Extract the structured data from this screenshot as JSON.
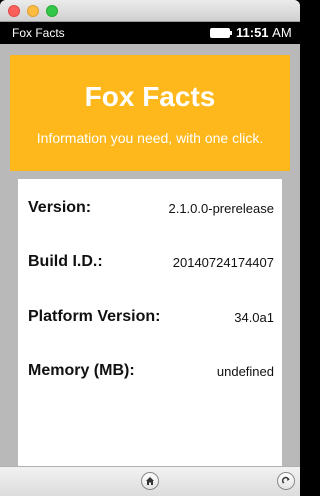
{
  "status_bar": {
    "app_title": "Fox Facts",
    "time": "11:51",
    "ampm": "AM"
  },
  "header": {
    "title": "Fox Facts",
    "subtitle": "Information you need, with one click."
  },
  "facts": [
    {
      "label": "Version:",
      "value": "2.1.0.0-prerelease"
    },
    {
      "label": "Build I.D.:",
      "value": "20140724174407"
    },
    {
      "label": "Platform Version:",
      "value": "34.0a1"
    },
    {
      "label": "Memory (MB):",
      "value": "undefined"
    }
  ],
  "colors": {
    "header_bg": "#ffb81c",
    "frame_bg": "#b9b9b9"
  },
  "icons": {
    "home": "home-icon",
    "refresh": "refresh-icon"
  }
}
